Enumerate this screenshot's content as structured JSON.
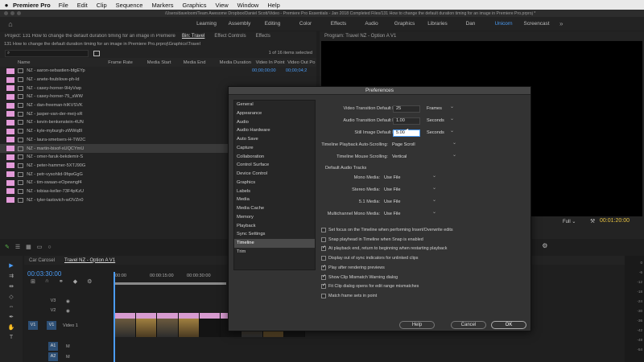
{
  "menubar": {
    "apple": "",
    "app": "Premiere Pro",
    "items": [
      "File",
      "Edit",
      "Clip",
      "Sequence",
      "Markers",
      "Graphics",
      "View",
      "Window",
      "Help"
    ]
  },
  "window": {
    "path": "/Users/daveloom/Team Awesome Dropbox/Daniel Scott/Video - Premiere Pro Essentials - Jan 2018 Completed Files/131 How to change the default duration timing for an image in Premiere Pro.prproj *"
  },
  "workspaces": {
    "items": [
      "Learning",
      "Assembly",
      "Editing",
      "Color",
      "Effects",
      "Audio",
      "Graphics",
      "Libraries",
      "Dan",
      "Unicorn",
      "Screencast"
    ],
    "active": "Unicorn",
    "more": "»"
  },
  "project_panel": {
    "tabs": [
      "Project: 131 How to change the default duration timing for an image in Premiere Pro",
      "Bin: Travel",
      "Effect Controls",
      "Effects"
    ],
    "path": "131 How to change the default duration timing for an image in Premiere Pro.prproj\\Graphics\\Travel",
    "search_placeholder": "",
    "selected_count": "1 of 16 items selected",
    "columns": [
      "Name",
      "Frame Rate",
      "Media Start",
      "Media End",
      "Media Duration",
      "Video In Point",
      "Video Out Po"
    ],
    "rows": [
      {
        "name": "NZ - aaron-sebastien-bfgEYp",
        "vin": "00;00;00;00",
        "vout": "00;00;04;2"
      },
      {
        "name": "NZ - anete-foubilove-ph-Id",
        "vin": "",
        "vout": ""
      },
      {
        "name": "NZ - casey-horner-9HyVwp",
        "vin": "",
        "vout": ""
      },
      {
        "name": "NZ - casey-horner-75_sWW",
        "vin": "",
        "vout": ""
      },
      {
        "name": "NZ - dan-freeman-hIKVSVK",
        "vin": "",
        "vout": ""
      },
      {
        "name": "NZ - jasper-van-der-meij-sR",
        "vin": "",
        "vout": ""
      },
      {
        "name": "NZ - kevin-benkenstein-4UN",
        "vin": "",
        "vout": ""
      },
      {
        "name": "NZ - kyle-myburgh-zWWq8I",
        "vin": "",
        "vout": ""
      },
      {
        "name": "NZ - laura-smetsers-H-TW2C",
        "vin": "",
        "vout": ""
      },
      {
        "name": "NZ - martin-bisof-xUQCYmU",
        "vin": "",
        "vout": "",
        "selected": true
      },
      {
        "name": "NZ - omer-faruk-bekdemir-S",
        "vin": "",
        "vout": ""
      },
      {
        "name": "NZ - peter-hammer-5XTJ90G",
        "vin": "",
        "vout": ""
      },
      {
        "name": "NZ - petr-vysohlid-9fqwGgG",
        "vin": "",
        "vout": ""
      },
      {
        "name": "NZ - tim-swaan-eOpewngf4",
        "vin": "",
        "vout": ""
      },
      {
        "name": "NZ - tobias-keller-73F4pKzU",
        "vin": "",
        "vout": ""
      },
      {
        "name": "NZ - tyler-lastovich-wOVZn0",
        "vin": "",
        "vout": ""
      }
    ]
  },
  "program_monitor": {
    "title": "Program: Travel NZ - Option A V1",
    "resolution": "Full",
    "duration": "00:01:20:00"
  },
  "timeline": {
    "tabs": [
      "Car Carosel",
      "Travel NZ - Option A V1"
    ],
    "timecode": "00:03:30:00",
    "ruler": [
      "00:00",
      "00:00:15:00",
      "00:00:30:00"
    ],
    "tracks": [
      {
        "label": "V3",
        "name": ""
      },
      {
        "label": "V2",
        "name": ""
      },
      {
        "label": "V1",
        "name": "Video 1"
      },
      {
        "label": "A1",
        "name": ""
      },
      {
        "label": "A2",
        "name": ""
      }
    ],
    "meter_scale": [
      "0",
      "-6",
      "-12",
      "-18",
      "-24",
      "-30",
      "-36",
      "-42",
      "-48",
      "-54"
    ]
  },
  "preferences": {
    "title": "Preferences",
    "categories": [
      "General",
      "Appearance",
      "Audio",
      "Audio Hardware",
      "Auto Save",
      "Capture",
      "Collaboration",
      "Control Surface",
      "Device Control",
      "Graphics",
      "Labels",
      "Media",
      "Media Cache",
      "Memory",
      "Playback",
      "Sync Settings",
      "Timeline",
      "Trim"
    ],
    "active_category": "Timeline",
    "video_transition": {
      "label": "Video Transition Default Duration:",
      "value": "25",
      "unit": "Frames"
    },
    "audio_transition": {
      "label": "Audio Transition Default Duration:",
      "value": "1.00",
      "unit": "Seconds"
    },
    "still_image": {
      "label": "Still Image Default Duration:",
      "value": "5.00",
      "unit": "Seconds"
    },
    "autoscroll": {
      "label": "Timeline Playback Auto-Scrolling:",
      "value": "Page Scroll"
    },
    "mouse_scroll": {
      "label": "Timeline Mouse Scrolling:",
      "value": "Vertical"
    },
    "default_audio_tracks": "Default Audio Tracks",
    "mono": {
      "label": "Mono Media:",
      "value": "Use File"
    },
    "stereo": {
      "label": "Stereo Media:",
      "value": "Use File"
    },
    "surround": {
      "label": "5.1 Media:",
      "value": "Use File"
    },
    "multichannel": {
      "label": "Multichannel Mono Media:",
      "value": "Use File"
    },
    "checkboxes": [
      {
        "label": "Set focus on the Timeline when performing Insert/Overwrite edits",
        "checked": false
      },
      {
        "label": "Snap playhead in Timeline when Snap is enabled",
        "checked": false
      },
      {
        "label": "At playback end, return to beginning when restarting playback",
        "checked": true
      },
      {
        "label": "Display out of sync indicators for unlinked clips",
        "checked": false
      },
      {
        "label": "Play after rendering previews",
        "checked": true
      },
      {
        "label": "Show Clip Mismatch Warning dialog",
        "checked": true
      },
      {
        "label": "Fit Clip dialog opens for edit range mismatches",
        "checked": true
      },
      {
        "label": "Match frame sets in point",
        "checked": false
      }
    ],
    "help_button": "Help",
    "cancel_button": "Cancel",
    "ok_button": "OK"
  }
}
